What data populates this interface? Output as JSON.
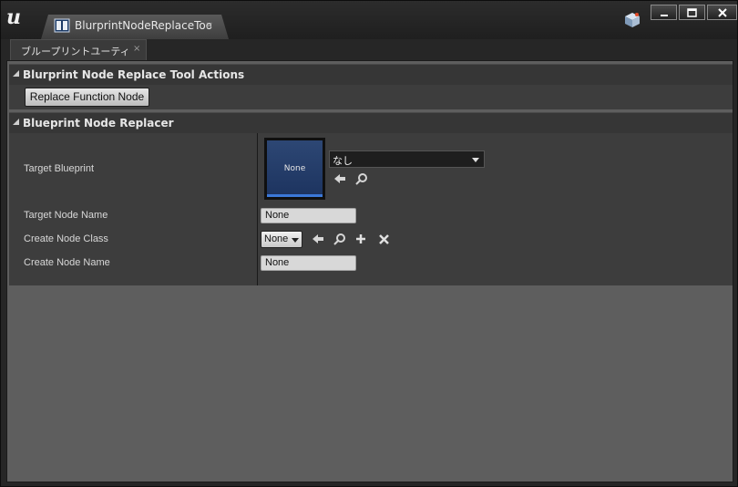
{
  "window": {
    "tab_title": "BlurprintNodeReplaceToo",
    "tab_close": "×",
    "panel_tab_label": "ブループリントユーティ",
    "panel_tab_close": "×"
  },
  "sections": {
    "actions": {
      "title": "Blurprint Node Replace Tool Actions",
      "replace_button_label": "Replace Function Node"
    },
    "replacer": {
      "title": "Blueprint Node Replacer",
      "rows": [
        {
          "label": "Target Blueprint"
        },
        {
          "label": "Target Node Name",
          "value": "None"
        },
        {
          "label": "Create Node Class",
          "value": "None"
        },
        {
          "label": "Create Node Name",
          "value": "None"
        }
      ],
      "asset_thumbnail_text": "None",
      "asset_combo_value": "なし"
    }
  },
  "colors": {
    "thumbnail_bg": "#2d4774",
    "thumbnail_bar": "#3b78d8"
  },
  "icons": [
    "ue-logo-icon",
    "book-icon",
    "source-control-icon",
    "minimize-icon",
    "maximize-icon",
    "close-icon",
    "back-arrow-icon",
    "search-icon",
    "plus-icon",
    "clear-icon"
  ]
}
